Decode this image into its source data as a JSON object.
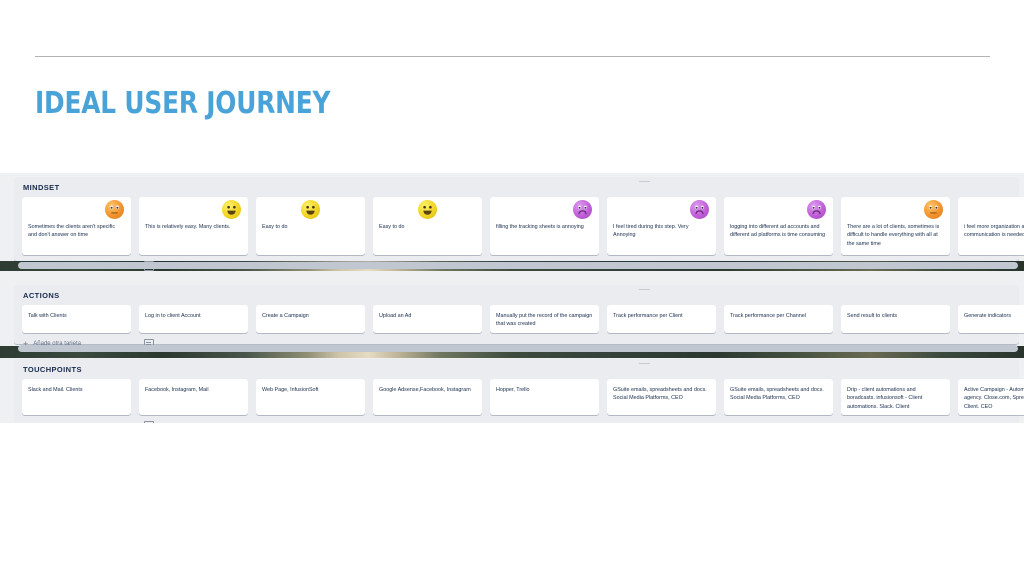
{
  "slide": {
    "title": "IDEAL USER JOURNEY"
  },
  "board": {
    "add_card_label": "Añade otra tarjeta",
    "template_icon": "card-template-icon",
    "plus_icon": "plus-icon",
    "swimlanes": [
      {
        "name": "MINDSET",
        "title": "MINDSET",
        "cards": [
          {
            "text": "Sometimes the clients aren't specific and don't answer on time",
            "emoji": "confused-face",
            "emoji_color": "#f2922c"
          },
          {
            "text": "This is relatively easy. Many clients.",
            "emoji": "happy-face",
            "emoji_color": "#f2d422"
          },
          {
            "text": "Easy to do",
            "emoji": "happy-face",
            "emoji_color": "#f2d422"
          },
          {
            "text": "Easy to do",
            "emoji": "happy-face",
            "emoji_color": "#f2d422"
          },
          {
            "text": "filling the tracking sheets is annoying",
            "emoji": "sad-face",
            "emoji_color": "#c05fd8"
          },
          {
            "text": "I feel tired during this step. Very Annoying",
            "emoji": "sad-face",
            "emoji_color": "#c05fd8"
          },
          {
            "text": "logging into different ad accounts and different ad platforms is time consuming",
            "emoji": "sad-face",
            "emoji_color": "#c05fd8"
          },
          {
            "text": "There are a lot of clients, sometimes is difficult to handle everything with all at the same time",
            "emoji": "confused-face",
            "emoji_color": "#f2922c"
          },
          {
            "text": "i feel more organization and communication is needed",
            "emoji": "sad-face",
            "emoji_color": "#c05fd8"
          }
        ]
      },
      {
        "name": "ACTIONS",
        "title": "ACTIONS",
        "cards": [
          {
            "text": "Talk with Clients"
          },
          {
            "text": "Log in to client Account"
          },
          {
            "text": "Create a Campaign"
          },
          {
            "text": "Upload an Ad"
          },
          {
            "text": "Manually put the record of the campaign that was created"
          },
          {
            "text": "Track performance per Client"
          },
          {
            "text": "Track performance per Channel"
          },
          {
            "text": "Send result to clients"
          },
          {
            "text": "Generate indicators"
          }
        ]
      },
      {
        "name": "TOUCHPOINTS",
        "title": "TOUCHPOINTS",
        "cards": [
          {
            "text": "Slack and Mail. Clients"
          },
          {
            "text": "Facebook, Instagram, Mail"
          },
          {
            "text": "Web Page, InfusionSoft"
          },
          {
            "text": "Google Adsense,Facebook, Instagram"
          },
          {
            "text": "Hopper, Trello"
          },
          {
            "text": "GSuite emails, spreadsheets and docs. Social Media Platforms, CEO"
          },
          {
            "text": "GSuite emails, spreadsheets and docs. Social Media Platforms, CEO"
          },
          {
            "text": "Drip - client automations and boradcasts. infusionsoft - Client automations. Slack. Client"
          },
          {
            "text": "Active Campaign - Automations for the agency. Close.com, Spreadsheets. Client. CEO"
          }
        ]
      }
    ]
  },
  "colors": {
    "accent": "#4aa3d8",
    "lane_bg": "#ebecf0",
    "card_bg": "#ffffff",
    "text": "#172b4d",
    "muted": "#5e6c84"
  }
}
